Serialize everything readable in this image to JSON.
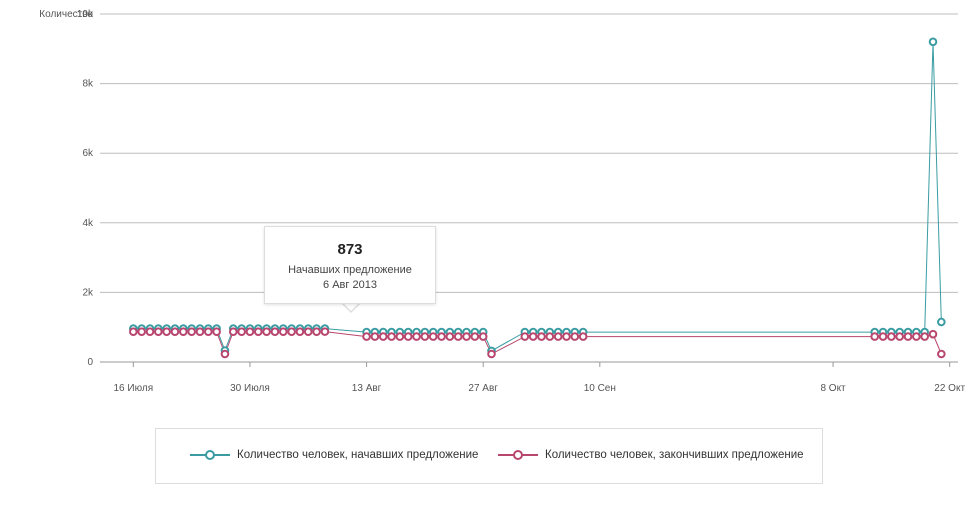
{
  "chart_data": {
    "type": "line",
    "ylabel": "Количество",
    "ylim": [
      0,
      10000
    ],
    "y_ticks": [
      "0",
      "2k",
      "4k",
      "6k",
      "8k",
      "10k"
    ],
    "x_range": [
      "2013-07-12",
      "2013-10-23"
    ],
    "x_ticks": [
      {
        "date": "2013-07-16",
        "label": "16 Июля"
      },
      {
        "date": "2013-07-30",
        "label": "30 Июля"
      },
      {
        "date": "2013-08-13",
        "label": "13 Авг"
      },
      {
        "date": "2013-08-27",
        "label": "27 Авг"
      },
      {
        "date": "2013-09-10",
        "label": "10 Сен"
      },
      {
        "date": "2013-10-08",
        "label": "8 Окт"
      },
      {
        "date": "2013-10-22",
        "label": "22 Окт"
      }
    ],
    "grid": true,
    "legend_position": "bottom",
    "series": [
      {
        "name": "Количество человек, начавших предложение",
        "color": "#3a9ca2",
        "points": [
          [
            "2013-07-16",
            960
          ],
          [
            "2013-07-17",
            960
          ],
          [
            "2013-07-18",
            960
          ],
          [
            "2013-07-19",
            960
          ],
          [
            "2013-07-20",
            960
          ],
          [
            "2013-07-21",
            960
          ],
          [
            "2013-07-22",
            960
          ],
          [
            "2013-07-23",
            960
          ],
          [
            "2013-07-24",
            960
          ],
          [
            "2013-07-25",
            960
          ],
          [
            "2013-07-26",
            960
          ],
          [
            "2013-07-27",
            330
          ],
          [
            "2013-07-28",
            960
          ],
          [
            "2013-07-29",
            960
          ],
          [
            "2013-07-30",
            960
          ],
          [
            "2013-07-31",
            960
          ],
          [
            "2013-08-01",
            960
          ],
          [
            "2013-08-02",
            960
          ],
          [
            "2013-08-03",
            960
          ],
          [
            "2013-08-04",
            960
          ],
          [
            "2013-08-05",
            960
          ],
          [
            "2013-08-06",
            960
          ],
          [
            "2013-08-07",
            960
          ],
          [
            "2013-08-08",
            960
          ],
          [
            "2013-08-13",
            860
          ],
          [
            "2013-08-14",
            860
          ],
          [
            "2013-08-15",
            860
          ],
          [
            "2013-08-16",
            860
          ],
          [
            "2013-08-17",
            860
          ],
          [
            "2013-08-18",
            860
          ],
          [
            "2013-08-19",
            860
          ],
          [
            "2013-08-20",
            860
          ],
          [
            "2013-08-21",
            860
          ],
          [
            "2013-08-22",
            860
          ],
          [
            "2013-08-23",
            860
          ],
          [
            "2013-08-24",
            860
          ],
          [
            "2013-08-25",
            860
          ],
          [
            "2013-08-26",
            860
          ],
          [
            "2013-08-27",
            860
          ],
          [
            "2013-08-28",
            320
          ],
          [
            "2013-09-01",
            860
          ],
          [
            "2013-09-02",
            860
          ],
          [
            "2013-09-03",
            860
          ],
          [
            "2013-09-04",
            860
          ],
          [
            "2013-09-05",
            860
          ],
          [
            "2013-09-06",
            860
          ],
          [
            "2013-09-07",
            860
          ],
          [
            "2013-09-08",
            860
          ],
          [
            "2013-10-13",
            860
          ],
          [
            "2013-10-14",
            860
          ],
          [
            "2013-10-15",
            860
          ],
          [
            "2013-10-16",
            860
          ],
          [
            "2013-10-17",
            860
          ],
          [
            "2013-10-18",
            860
          ],
          [
            "2013-10-19",
            860
          ],
          [
            "2013-10-20",
            9200
          ],
          [
            "2013-10-21",
            1150
          ]
        ]
      },
      {
        "name": "Количество человек, закончивших предложение",
        "color": "#b8466e",
        "points": [
          [
            "2013-07-16",
            870
          ],
          [
            "2013-07-17",
            870
          ],
          [
            "2013-07-18",
            870
          ],
          [
            "2013-07-19",
            870
          ],
          [
            "2013-07-20",
            870
          ],
          [
            "2013-07-21",
            870
          ],
          [
            "2013-07-22",
            870
          ],
          [
            "2013-07-23",
            870
          ],
          [
            "2013-07-24",
            870
          ],
          [
            "2013-07-25",
            870
          ],
          [
            "2013-07-26",
            870
          ],
          [
            "2013-07-27",
            230
          ],
          [
            "2013-07-28",
            870
          ],
          [
            "2013-07-29",
            870
          ],
          [
            "2013-07-30",
            870
          ],
          [
            "2013-07-31",
            870
          ],
          [
            "2013-08-01",
            870
          ],
          [
            "2013-08-02",
            870
          ],
          [
            "2013-08-03",
            870
          ],
          [
            "2013-08-04",
            870
          ],
          [
            "2013-08-05",
            870
          ],
          [
            "2013-08-06",
            870
          ],
          [
            "2013-08-07",
            870
          ],
          [
            "2013-08-08",
            873
          ],
          [
            "2013-08-13",
            730
          ],
          [
            "2013-08-14",
            730
          ],
          [
            "2013-08-15",
            730
          ],
          [
            "2013-08-16",
            730
          ],
          [
            "2013-08-17",
            730
          ],
          [
            "2013-08-18",
            730
          ],
          [
            "2013-08-19",
            730
          ],
          [
            "2013-08-20",
            730
          ],
          [
            "2013-08-21",
            730
          ],
          [
            "2013-08-22",
            730
          ],
          [
            "2013-08-23",
            730
          ],
          [
            "2013-08-24",
            730
          ],
          [
            "2013-08-25",
            730
          ],
          [
            "2013-08-26",
            730
          ],
          [
            "2013-08-27",
            730
          ],
          [
            "2013-08-28",
            230
          ],
          [
            "2013-09-01",
            730
          ],
          [
            "2013-09-02",
            730
          ],
          [
            "2013-09-03",
            730
          ],
          [
            "2013-09-04",
            730
          ],
          [
            "2013-09-05",
            730
          ],
          [
            "2013-09-06",
            730
          ],
          [
            "2013-09-07",
            730
          ],
          [
            "2013-09-08",
            730
          ],
          [
            "2013-10-13",
            730
          ],
          [
            "2013-10-14",
            730
          ],
          [
            "2013-10-15",
            730
          ],
          [
            "2013-10-16",
            730
          ],
          [
            "2013-10-17",
            730
          ],
          [
            "2013-10-18",
            730
          ],
          [
            "2013-10-19",
            730
          ],
          [
            "2013-10-20",
            800
          ],
          [
            "2013-10-21",
            230
          ]
        ]
      }
    ]
  },
  "tooltip": {
    "value": "873",
    "label": "Начавших предложение",
    "date": "6 Авг 2013"
  },
  "legend": {
    "items": [
      {
        "label": "Количество человек, начавших предложение"
      },
      {
        "label": "Количество человек, закончивших предложение"
      }
    ]
  }
}
